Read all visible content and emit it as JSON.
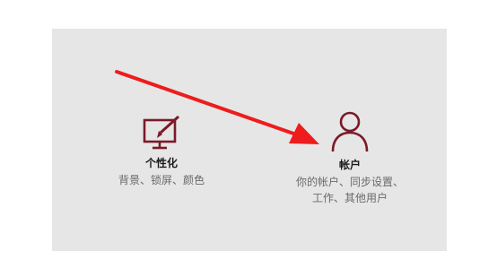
{
  "settings": {
    "tiles": [
      {
        "title": "个性化",
        "description": "背景、锁屏、颜色",
        "icon": "personalization-icon"
      },
      {
        "title": "帐户",
        "description_line1": "你的帐户、同步设置、",
        "description_line2": "工作、其他用户",
        "icon": "account-person-icon"
      }
    ]
  },
  "colors": {
    "icon_accent": "#7a1a28",
    "annotation_arrow": "#ee1c1c"
  }
}
